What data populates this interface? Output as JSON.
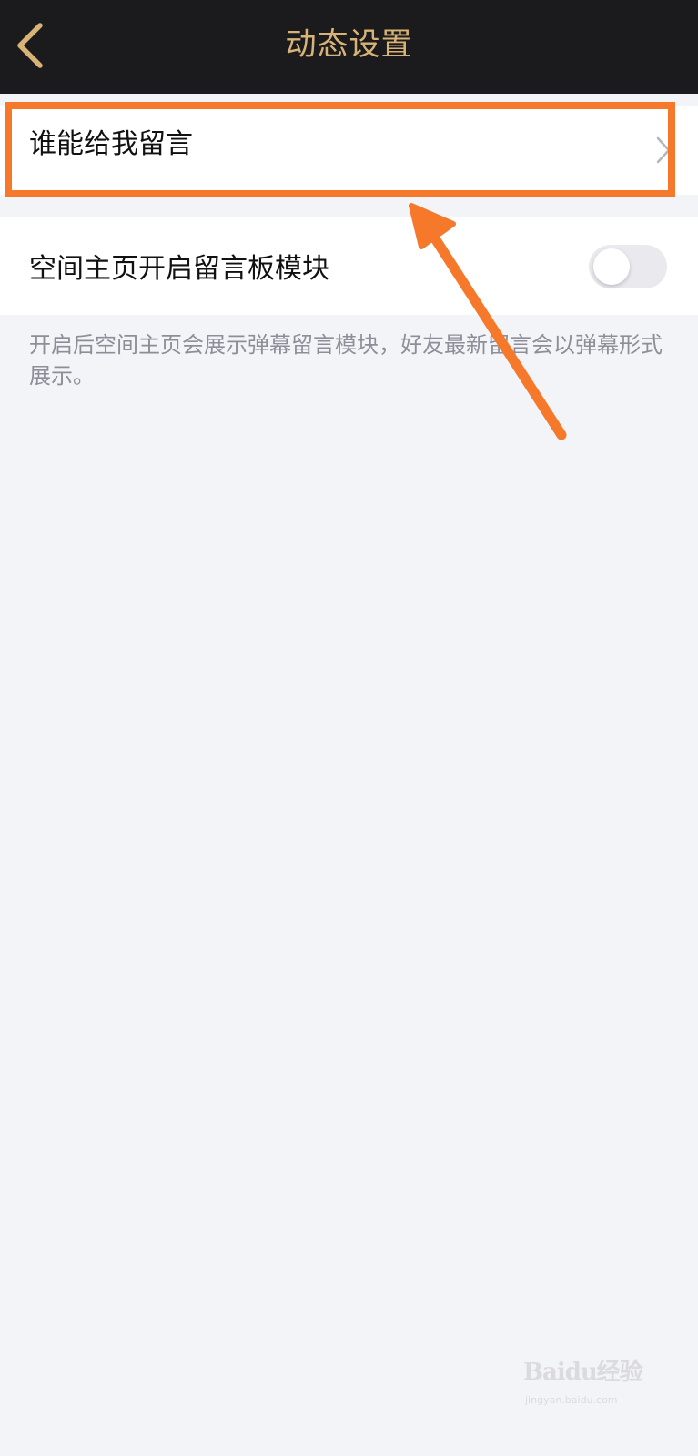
{
  "header": {
    "title": "动态设置",
    "back_icon": "chevron-left-icon",
    "title_color": "#d8b377",
    "background": "#1b1b1d"
  },
  "settings": {
    "who_can_message": {
      "label": "谁能给我留言",
      "icon": "chevron-right-icon"
    },
    "message_board": {
      "label": "空间主页开启留言板模块",
      "toggle_on": false
    },
    "description": "开启后空间主页会展示弹幕留言模块，好友最新留言会以弹幕形式展示。"
  },
  "annotation": {
    "highlight_color": "#f6782b"
  },
  "watermark": {
    "logo": "Baidu经验",
    "url": "jingyan.baidu.com"
  }
}
